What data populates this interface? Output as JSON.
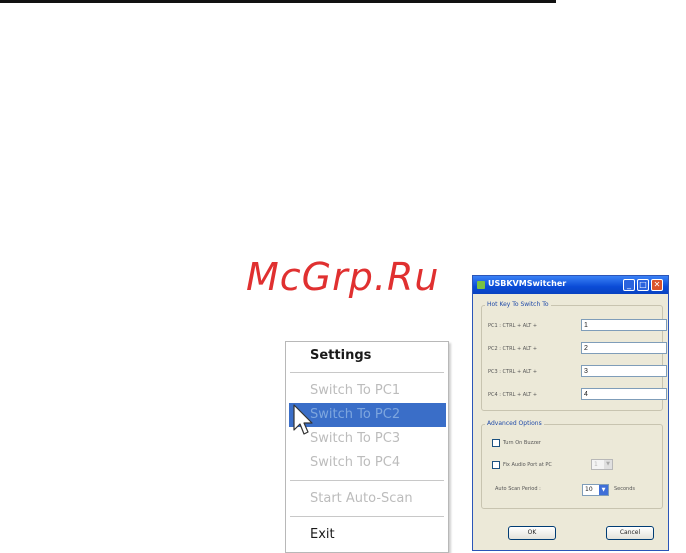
{
  "watermark": "McGrp.Ru",
  "context_menu": {
    "items": [
      {
        "label": "Settings"
      },
      {
        "label": "Switch To PC1"
      },
      {
        "label": "Switch To PC2"
      },
      {
        "label": "Switch To PC3"
      },
      {
        "label": "Switch To PC4"
      },
      {
        "label": "Start Auto-Scan"
      },
      {
        "label": "Exit"
      }
    ],
    "highlighted": "Switch To PC2"
  },
  "dialog": {
    "title": "USBKVMSwitcher",
    "hotkey_group": "Hot Key To Switch To",
    "hotkeys": [
      {
        "label": "PC1 : CTRL + ALT +",
        "value": "1"
      },
      {
        "label": "PC2 : CTRL + ALT +",
        "value": "2"
      },
      {
        "label": "PC3 : CTRL + ALT +",
        "value": "3"
      },
      {
        "label": "PC4 : CTRL + ALT +",
        "value": "4"
      }
    ],
    "advanced_group": "Advanced Options",
    "buzzer_label": "Turn On Buzzer",
    "fix_audio_label": "Fix Audio Port at PC",
    "fix_audio_value": "1",
    "auto_scan_label": "Auto Scan Period :",
    "auto_scan_value": "10",
    "auto_scan_unit": "Seconds",
    "ok_label": "OK",
    "cancel_label": "Cancel"
  },
  "colors": {
    "highlight": "#3a6ec8",
    "titlebar": "#0a4bd6",
    "dialog_bg": "#ece9d8",
    "watermark": "#e03030"
  }
}
